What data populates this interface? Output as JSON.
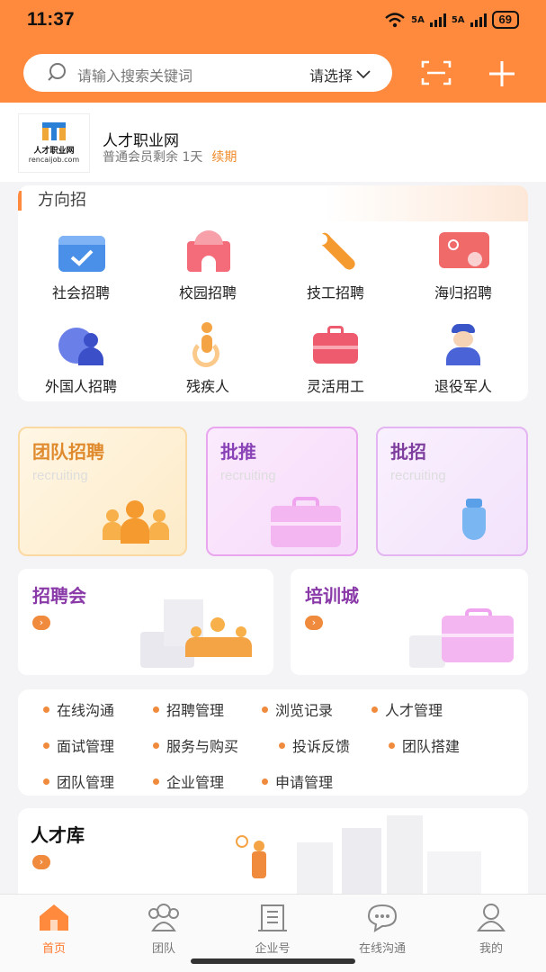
{
  "status_bar": {
    "time": "11:37",
    "net1": "5A",
    "net2": "5A",
    "battery": "69"
  },
  "search": {
    "placeholder": "请输入搜索关键词",
    "select_label": "请选择"
  },
  "company": {
    "name": "人才职业网",
    "membership": "普通会员剩余 1天",
    "renew": "续期",
    "logo_cn": "人才职业网",
    "logo_en": "rencaijob.com"
  },
  "direction": {
    "title": "方向招",
    "items": [
      {
        "label": "社会招聘",
        "icon": "briefcase-check-icon"
      },
      {
        "label": "校园招聘",
        "icon": "school-building-icon"
      },
      {
        "label": "技工招聘",
        "icon": "wrench-icon"
      },
      {
        "label": "海归招聘",
        "icon": "id-card-icon"
      },
      {
        "label": "外国人招聘",
        "icon": "globe-person-icon"
      },
      {
        "label": "残疾人",
        "icon": "wheelchair-icon"
      },
      {
        "label": "灵活用工",
        "icon": "toolbox-icon"
      },
      {
        "label": "退役军人",
        "icon": "soldier-icon"
      }
    ]
  },
  "big_cards": [
    {
      "title": "团队招聘",
      "subtitle": "recruiting"
    },
    {
      "title": "批推",
      "subtitle": "recruiting"
    },
    {
      "title": "批招",
      "subtitle": "recruiting"
    }
  ],
  "mid_cards": [
    {
      "title": "招聘会"
    },
    {
      "title": "培训城"
    }
  ],
  "quick_links": [
    "在线沟通",
    "招聘管理",
    "浏览记录",
    "人才管理",
    "面试管理",
    "服务与购买",
    "投诉反馈",
    "团队搭建",
    "团队管理",
    "企业管理",
    "申请管理"
  ],
  "talent": {
    "title": "人才库"
  },
  "tabbar": [
    {
      "label": "首页",
      "icon": "home-icon",
      "active": true
    },
    {
      "label": "团队",
      "icon": "team-icon",
      "active": false
    },
    {
      "label": "企业号",
      "icon": "building-icon",
      "active": false
    },
    {
      "label": "在线沟通",
      "icon": "chat-icon",
      "active": false
    },
    {
      "label": "我的",
      "icon": "profile-icon",
      "active": false
    }
  ],
  "colors": {
    "brand": "#ff8a3d",
    "accent_purple": "#8a3aa8",
    "active_tab": "#ff7a2e"
  }
}
